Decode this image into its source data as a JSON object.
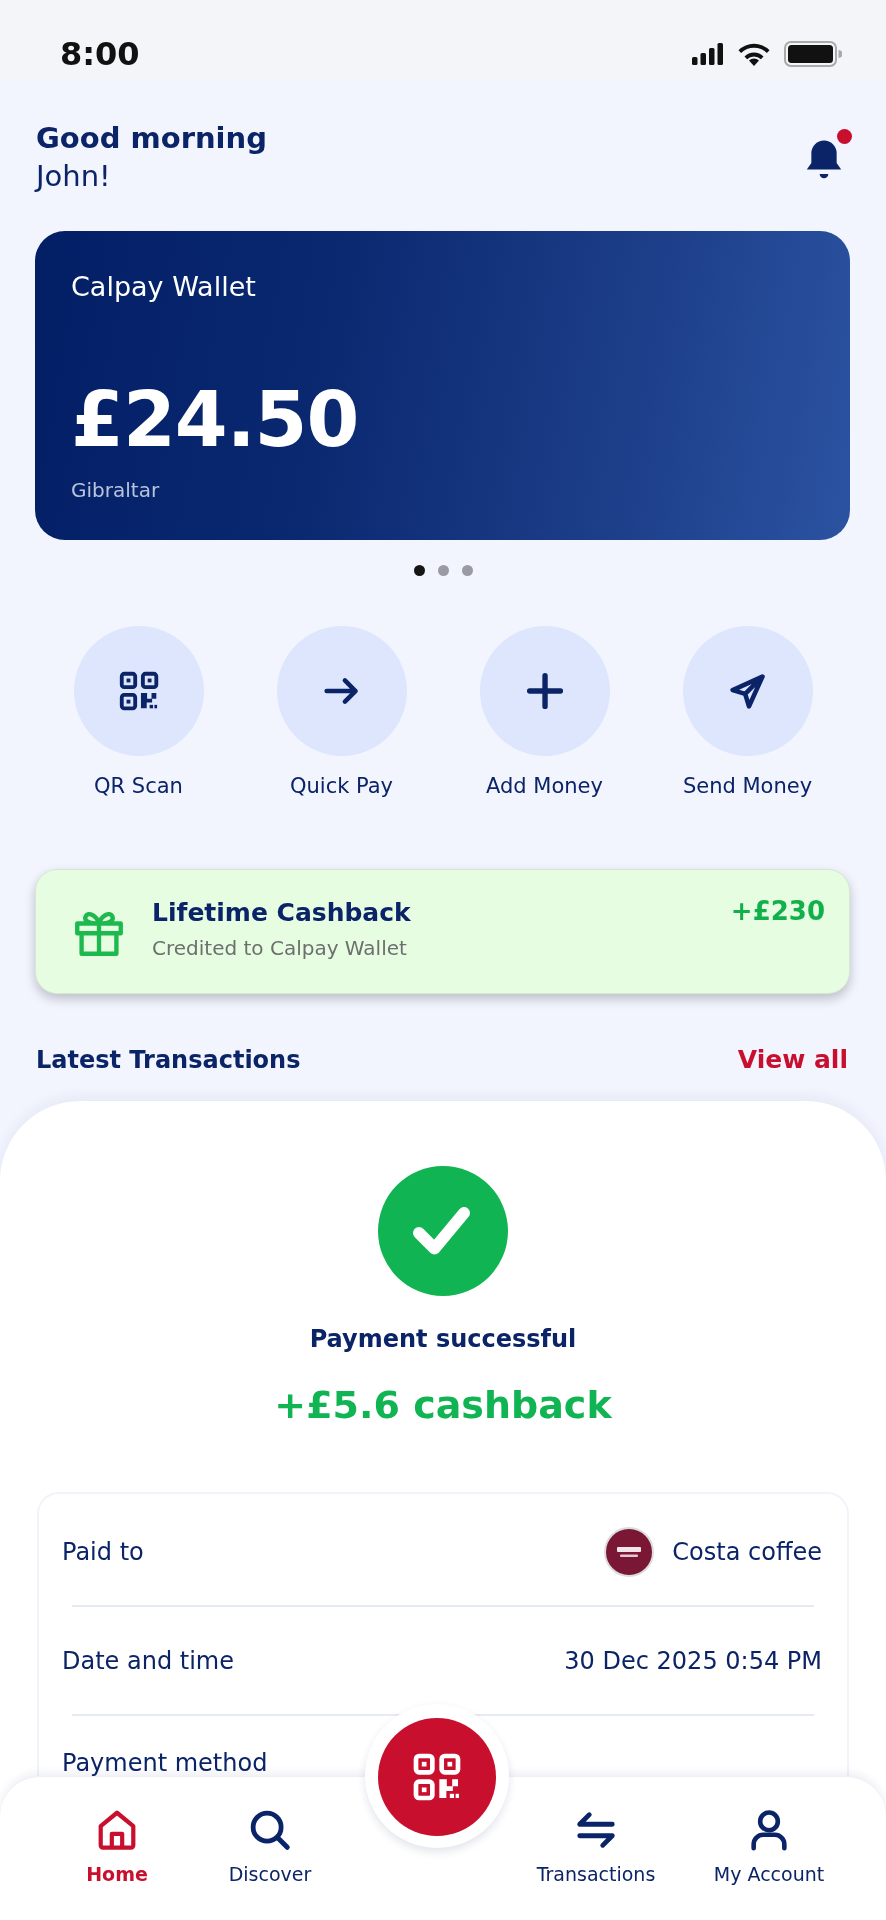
{
  "status_bar": {
    "time": "8:00"
  },
  "greeting": {
    "line_1": "Good morning",
    "line_2": "John!",
    "notifications_unread": true
  },
  "wallet_card": {
    "title": "Calpay Wallet",
    "balance": "£24.50",
    "region": "Gibraltar"
  },
  "carousel": {
    "pages": [
      {
        "selected": true
      },
      {
        "selected": false
      },
      {
        "selected": false
      }
    ]
  },
  "quick_actions": [
    {
      "label": "QR Scan",
      "kind": "qr"
    },
    {
      "label": "Quick Pay",
      "kind": "arrow"
    },
    {
      "label": "Add Money",
      "kind": "plus"
    },
    {
      "label": "Send Money",
      "kind": "send"
    }
  ],
  "cashback_banner": {
    "title": "Lifetime Cashback",
    "subtitle": "Credited to Calpay Wallet",
    "amount": "+£230"
  },
  "transactions_header": {
    "title": "Latest Transactions",
    "link": "View all"
  },
  "payment_result": {
    "success": true,
    "message": "Payment successful",
    "cashback": "+£5.6 cashback"
  },
  "details": [
    {
      "label": "Paid to",
      "value": "Costa coffee",
      "kind": "merchant"
    },
    {
      "label": "Date and time",
      "value": "30 Dec 2025 0:54 PM",
      "kind": "text"
    },
    {
      "label": "Payment method"
    }
  ],
  "bottom_nav": {
    "items": [
      {
        "label": "Home",
        "kind": "home",
        "selected": true
      },
      {
        "label": "Discover",
        "kind": "search",
        "selected": false
      },
      {
        "label": "Transactions",
        "kind": "transfer",
        "selected": false
      },
      {
        "label": "My Account",
        "kind": "account",
        "selected": false
      }
    ]
  }
}
